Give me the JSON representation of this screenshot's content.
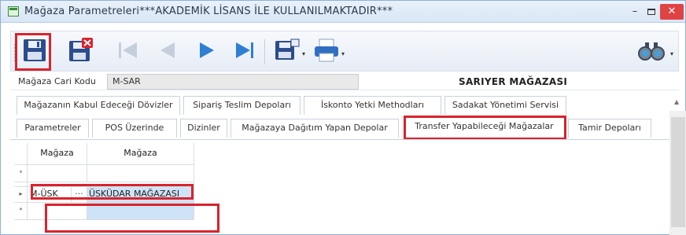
{
  "window": {
    "title": "Mağaza Parametreleri***AKADEMİK LİSANS İLE KULLANILMAKTADIR***",
    "minimize_label": "–",
    "close_label": "✕"
  },
  "toolbar": {
    "buttons": [
      "save-icon",
      "delete-icon",
      "first-record-icon",
      "previous-record-icon",
      "next-record-icon",
      "last-record-icon",
      "export-icon",
      "print-icon",
      "find-icon"
    ]
  },
  "form": {
    "store_code_label": "Mağaza Cari Kodu",
    "store_code_value": "M-SAR",
    "store_name": "SARIYER MAĞAZASI"
  },
  "tabs": {
    "row1": [
      "Mağazanın Kabul Edeceği Dövizler",
      "Sipariş Teslim Depoları",
      "İskonto Yetki Methodları",
      "Sadakat Yönetimi Servisi"
    ],
    "row2": [
      "Parametreler",
      "POS Üzerinde",
      "Dizinler",
      "Mağazaya Dağıtım Yapan Depolar",
      "Transfer Yapabileceği Mağazalar",
      "Tamir Depoları"
    ],
    "active": "Transfer Yapabileceği Mağazalar"
  },
  "grid": {
    "columns": [
      "Mağaza",
      "Mağaza"
    ],
    "rows": [
      {
        "code": "M-ÜSK",
        "ellipsis": "···",
        "name": "ÜSKÜDAR MAĞAZASI"
      }
    ],
    "filter_row_indicator": "ᵠ",
    "new_row_indicator": "*"
  },
  "colors": {
    "highlight": "#d9232d",
    "selected_cell": "#cfe3f6",
    "close_button": "#e04343"
  }
}
